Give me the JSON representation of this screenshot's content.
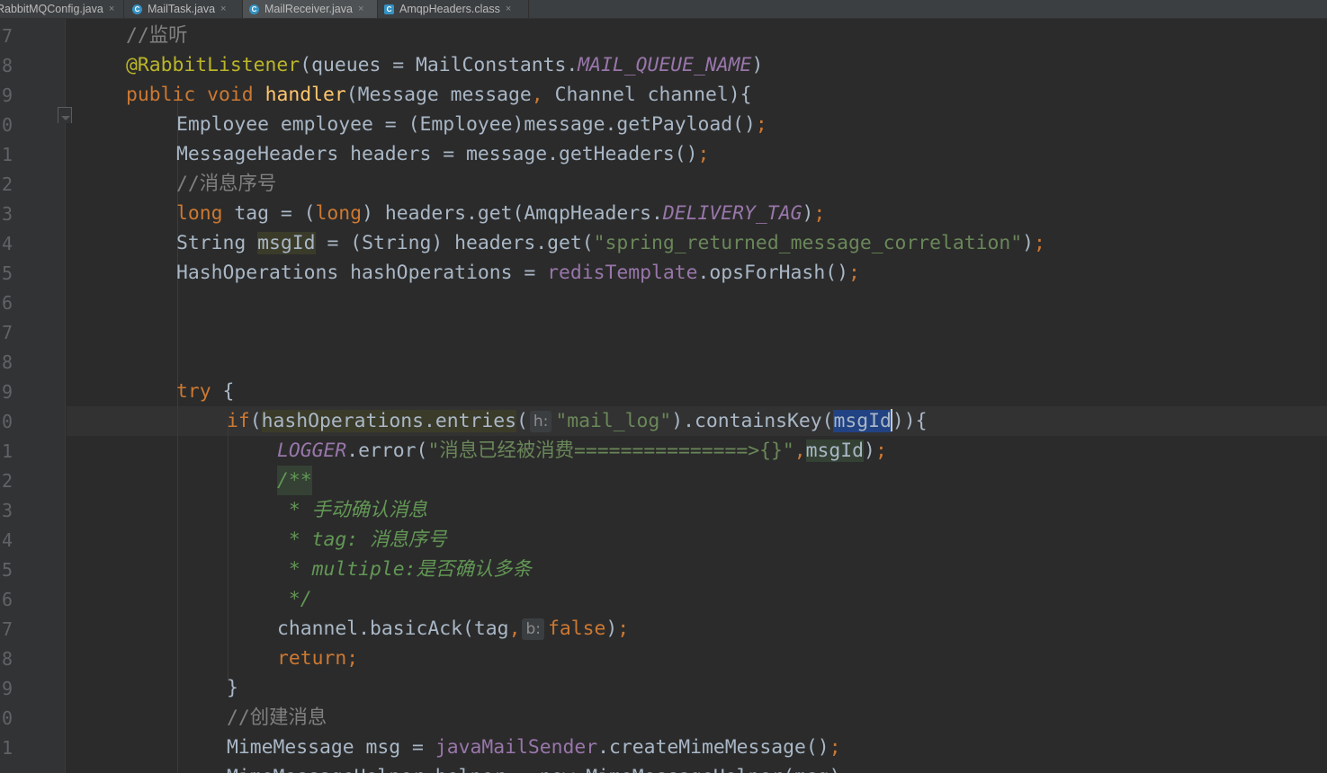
{
  "tabs": [
    {
      "label": "RabbitMQConfig.java",
      "close": "×",
      "active": false
    },
    {
      "label": "MailTask.java",
      "close": "×",
      "active": false
    },
    {
      "label": "MailReceiver.java",
      "close": "×",
      "active": true
    },
    {
      "label": "AmqpHeaders.class",
      "close": "×",
      "active": false
    }
  ],
  "line_numbers": [
    "7",
    "8",
    "9",
    "0",
    "1",
    "2",
    "3",
    "4",
    "5",
    "6",
    "7",
    "8",
    "9",
    "0",
    "1",
    "2",
    "3",
    "4",
    "5",
    "6",
    "7",
    "8",
    "9",
    "0",
    "1"
  ],
  "code": {
    "l1_comment": "//监听",
    "l2_ann": "@RabbitListener",
    "l2_a": "(queues = MailConstants.",
    "l2_const": "MAIL_QUEUE_NAME",
    "l2_b": ")",
    "l3_kw1": "public",
    "l3_kw2": "void",
    "l3_fn": "handler",
    "l3_a": "(Message message",
    "l3_comma": ",",
    "l3_b": " Channel channel){",
    "l4_a": "Employee employee = (Employee)message.getPayload()",
    "l4_semi": ";",
    "l5_a": "MessageHeaders headers = message.getHeaders()",
    "l5_semi": ";",
    "l6_comment": "//消息序号",
    "l7_kw1": "long",
    "l7_a": " tag = (",
    "l7_kw2": "long",
    "l7_b": ") headers.get(AmqpHeaders.",
    "l7_const": "DELIVERY_TAG",
    "l7_c": ")",
    "l7_semi": ";",
    "l8_a": "String ",
    "l8_var": "msgId",
    "l8_b": " = (String) headers.get(",
    "l8_str": "\"spring_returned_message_correlation\"",
    "l8_c": ")",
    "l8_semi": ";",
    "l9_a": "HashOperations hashOperations = ",
    "l9_field": "redisTemplate",
    "l9_b": ".opsForHash()",
    "l9_semi": ";",
    "l13_kw": "try",
    "l13_a": " {",
    "l14_kw": "if",
    "l14_a": "(",
    "l14_b": "hashOperations.entries",
    "l14_c": "(",
    "l14_hint": "h:",
    "l14_str": "\"mail_log\"",
    "l14_d": ").containsKey(",
    "l14_sel": "msgId",
    "l14_e": ")){",
    "l15_const": "LOGGER",
    "l15_a": ".error(",
    "l15_str": "\"消息已经被消费===============>{}\"",
    "l15_comma": ",",
    "l15_var": "msgId",
    "l15_b": ")",
    "l15_semi": ";",
    "l16_doc": "/**",
    "l17_doc": " * 手动确认消息",
    "l18_doc": " * tag: 消息序号",
    "l19_doc": " * multiple:是否确认多条",
    "l20_doc": " */",
    "l21_a": "channel.basicAck(tag",
    "l21_comma": ",",
    "l21_hint": "b:",
    "l21_kw": "false",
    "l21_b": ")",
    "l21_semi": ";",
    "l22_kw": "return",
    "l22_semi": ";",
    "l23_a": "}",
    "l24_comment": "//创建消息",
    "l25_a": "MimeMessage msg = ",
    "l25_field": "javaMailSender",
    "l25_b": ".createMimeMessage()",
    "l25_semi": ";",
    "l26_a": "MimeMessageHelper helper = new MimeMessageHelper(msg)"
  },
  "colors": {
    "background": "#2b2b2b",
    "keyword": "#cc7832",
    "annotation": "#bbb529",
    "constant": "#9876aa",
    "string": "#6a8759",
    "comment": "#808080",
    "doc_comment": "#629755",
    "method_decl": "#ffc66d",
    "plain": "#a9b7c6",
    "selection": "#214283"
  }
}
